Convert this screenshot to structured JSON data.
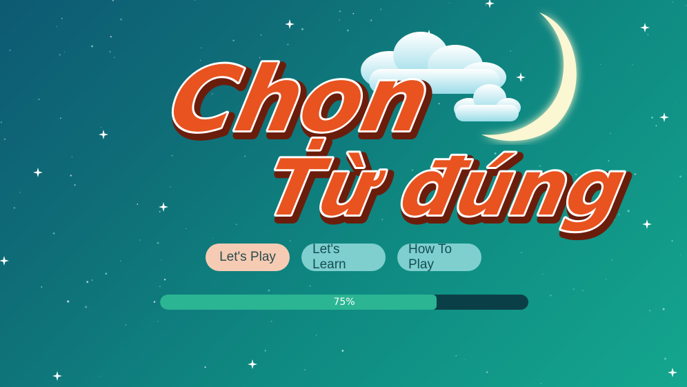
{
  "game": {
    "title_line1": "Chọn",
    "title_line2": "Từ đúng",
    "progress_label": "75%",
    "progress_value": 0.75
  },
  "menu": {
    "play_label": "Let's Play",
    "learn_label": "Let's Learn",
    "howto_label": "How To Play"
  },
  "colors": {
    "title_fill": "#e8531f",
    "title_stroke": "#ffffff",
    "title_shadow": "#6b1d0c",
    "play_button": "#f6cbb4",
    "secondary_button": "#7fcfcf",
    "progress_fill": "#2bb593",
    "progress_track": "#0b3f48"
  },
  "icons": {
    "moon": "crescent-moon",
    "clouds": "clouds",
    "stars": "sparkle-stars"
  }
}
